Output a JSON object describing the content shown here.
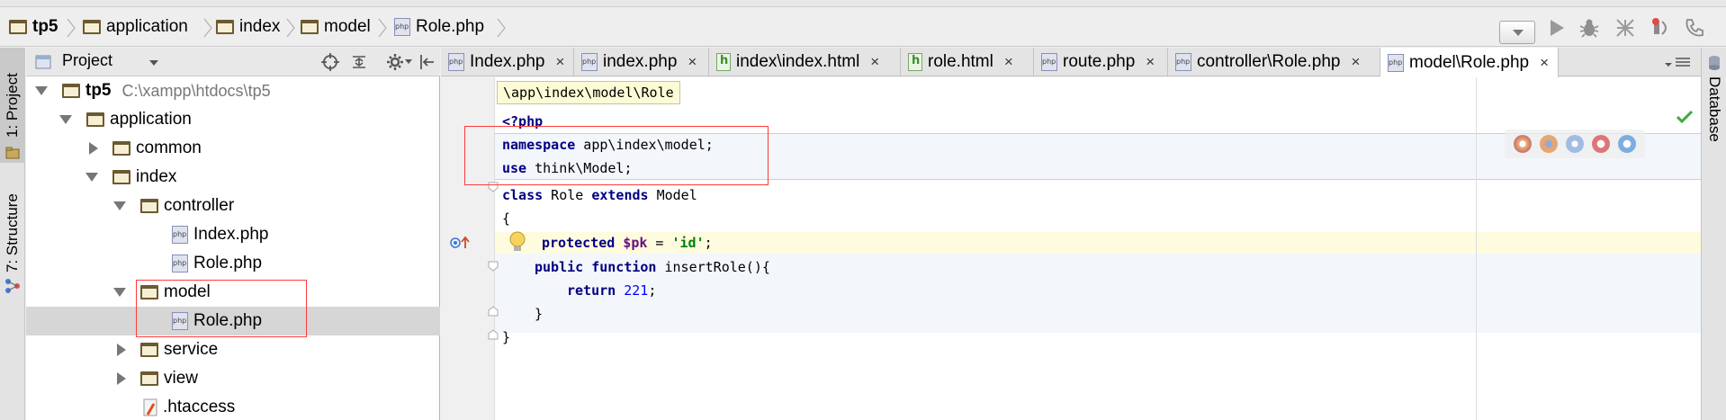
{
  "navbar": {
    "crumbs": [
      "tp5",
      "application",
      "index",
      "model",
      "Role.php"
    ]
  },
  "left_tools": {
    "project": "1: Project",
    "structure": "7: Structure"
  },
  "right_tools": {
    "database": "Database"
  },
  "project_panel": {
    "title": "Project",
    "tree": [
      {
        "label": "tp5",
        "path": "C:\\xampp\\htdocs\\tp5"
      },
      {
        "label": "application"
      },
      {
        "label": "common"
      },
      {
        "label": "index"
      },
      {
        "label": "controller"
      },
      {
        "label": "Index.php"
      },
      {
        "label": "Role.php"
      },
      {
        "label": "model"
      },
      {
        "label": "Role.php"
      },
      {
        "label": "service"
      },
      {
        "label": "view"
      },
      {
        "label": ".htaccess"
      }
    ]
  },
  "tabs": [
    {
      "label": "Index.php",
      "close": "×"
    },
    {
      "label": "index.php",
      "close": "×"
    },
    {
      "label": "index\\index.html",
      "close": "×"
    },
    {
      "label": "role.html",
      "close": "×"
    },
    {
      "label": "route.php",
      "close": "×"
    },
    {
      "label": "controller\\Role.php",
      "close": "×"
    },
    {
      "label": "model\\Role.php",
      "close": "×"
    }
  ],
  "editor": {
    "tooltip": "\\app\\index\\model\\Role",
    "code": {
      "l1": "<?php",
      "l2_kw": "namespace",
      "l2_rest": " app\\index\\model;",
      "l3_kw": "use",
      "l3_rest": " think\\Model;",
      "l4_kw1": "class",
      "l4_mid": " Role ",
      "l4_kw2": "extends",
      "l4_rest": " Model",
      "l5": "{",
      "l6_kw": "protected",
      "l6_var": " $pk",
      "l6_eq": " = ",
      "l6_str": "'id'",
      "l6_end": ";",
      "l7_kw1": "public",
      "l7_kw2": " function",
      "l7_rest": " insertRole(){",
      "l8_kw": "return",
      "l8_num": " 221",
      "l8_end": ";",
      "l9": "}",
      "l10": "}"
    }
  },
  "colors": {
    "keyword": "#000080",
    "string": "#008000",
    "number": "#0000ff",
    "highlight": "#ff3b3b"
  }
}
